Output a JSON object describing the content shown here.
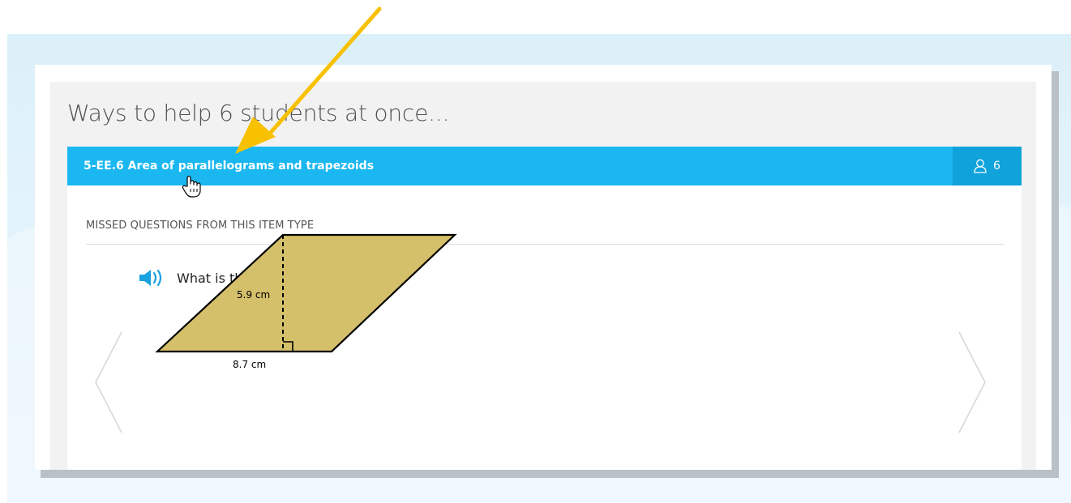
{
  "panel": {
    "title": "Ways to help 6 students at once..."
  },
  "skill": {
    "name": "5-EE.6 Area of parallelograms and trapezoids",
    "student_count": "6",
    "bar_color": "#1bb7f0"
  },
  "section": {
    "label": "MISSED QUESTIONS FROM THIS ITEM TYPE"
  },
  "question": {
    "text": "What is the area?",
    "height_label": "5.9 cm",
    "base_label": "8.7 cm",
    "shape_color": "#d4bf6a"
  },
  "icons": {
    "audio": "speaker-icon",
    "students": "person-icon",
    "prev": "chevron-left-icon",
    "next": "chevron-right-icon",
    "cursor": "hand-cursor-icon",
    "annotation": "arrow-annotation-icon"
  },
  "annotation_color": "#f7c100"
}
